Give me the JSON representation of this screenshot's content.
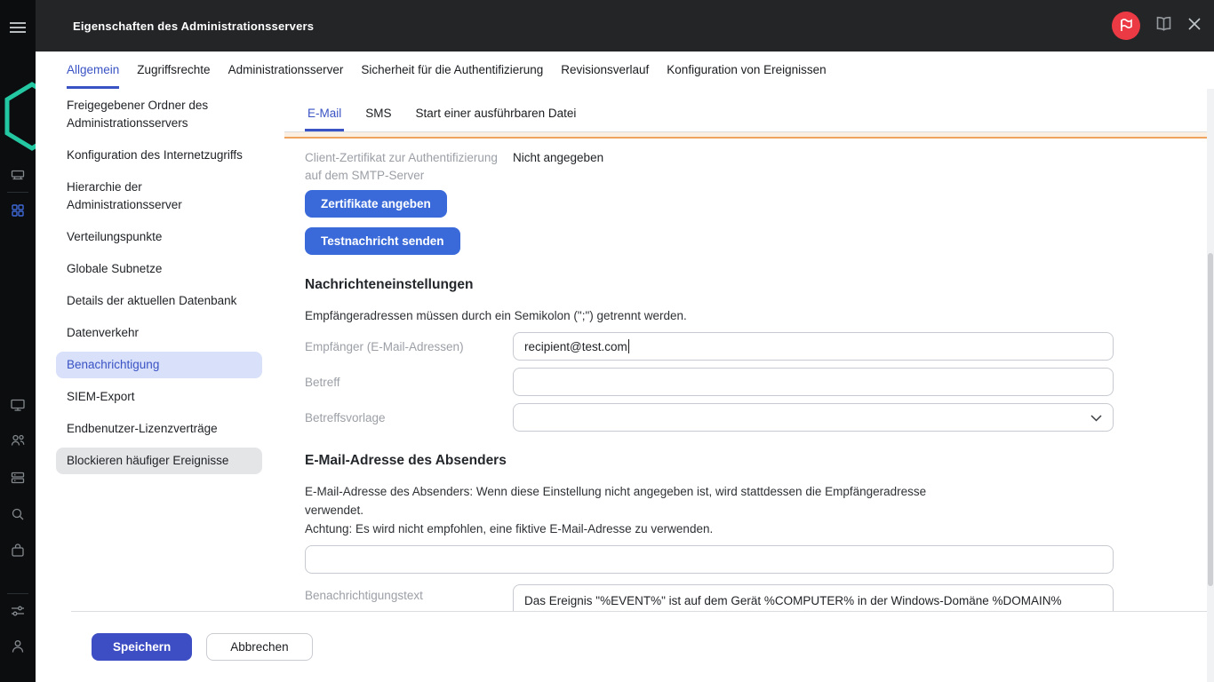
{
  "colors": {
    "accent": "#3A53C4",
    "primary_button": "#3A6AD9",
    "save_button": "#3D4DC3",
    "selected_item_bg": "#D8E0FA",
    "hovered_item_bg": "#E4E5E7",
    "warning_line": "#F0A35E",
    "badge_red": "#EB3A44",
    "logo_teal": "#23C8A2"
  },
  "window": {
    "title": "Eigenschaften des Administrationsservers"
  },
  "tabs": [
    {
      "label": "Allgemein"
    },
    {
      "label": "Zugriffsrechte"
    },
    {
      "label": "Administrationsserver"
    },
    {
      "label": "Sicherheit für die Authentifizierung"
    },
    {
      "label": "Revisionsverlauf"
    },
    {
      "label": "Konfiguration von Ereignissen"
    }
  ],
  "sidebar": {
    "items": [
      {
        "label": "Freigegebener Ordner des Administrationsservers"
      },
      {
        "label": "Konfiguration des Internetzugriffs"
      },
      {
        "label": "Hierarchie der Administrationsserver"
      },
      {
        "label": "Verteilungspunkte"
      },
      {
        "label": "Globale Subnetze"
      },
      {
        "label": "Details der aktuellen Datenbank"
      },
      {
        "label": "Datenverkehr"
      },
      {
        "label": "Benachrichtigung",
        "state": "selected"
      },
      {
        "label": "SIEM-Export"
      },
      {
        "label": "Endbenutzer-Lizenzverträge"
      },
      {
        "label": "Blockieren häufiger Ereignisse",
        "state": "hovered"
      }
    ]
  },
  "subtabs": [
    {
      "label": "E-Mail"
    },
    {
      "label": "SMS"
    },
    {
      "label": "Start einer ausführbaren Datei"
    }
  ],
  "email_settings": {
    "client_cert_label": "Client-Zertifikat zur Authentifizierung auf dem SMTP-Server",
    "client_cert_value": "Nicht angegeben",
    "specify_certificates_button": "Zertifikate angeben",
    "send_test_message_button": "Testnachricht senden"
  },
  "message_settings": {
    "heading": "Nachrichteneinstellungen",
    "hint": "Empfängeradressen müssen durch ein Semikolon (\";\") getrennt werden.",
    "recipients_label": "Empfänger (E-Mail-Adressen)",
    "recipients_value": "recipient@test.com",
    "subject_label": "Betreff",
    "subject_value": "",
    "subject_template_label": "Betreffsvorlage",
    "subject_template_value": ""
  },
  "sender_section": {
    "heading": "E-Mail-Adresse des Absenders",
    "description_line1": "E-Mail-Adresse des Absenders: Wenn diese Einstellung nicht angegeben ist, wird stattdessen die Empfängeradresse",
    "description_line2": "verwendet.",
    "description_line3": "Achtung: Es wird nicht empfohlen, eine fiktive E-Mail-Adresse zu verwenden.",
    "sender_value": ""
  },
  "notification_text": {
    "label": "Benachrichtigungstext",
    "value": "Das Ereignis \"%EVENT%\" ist auf dem Gerät %COMPUTER% in der Windows-Domäne %DOMAIN%"
  },
  "footer": {
    "save_button": "Speichern",
    "cancel_button": "Abbrechen"
  }
}
